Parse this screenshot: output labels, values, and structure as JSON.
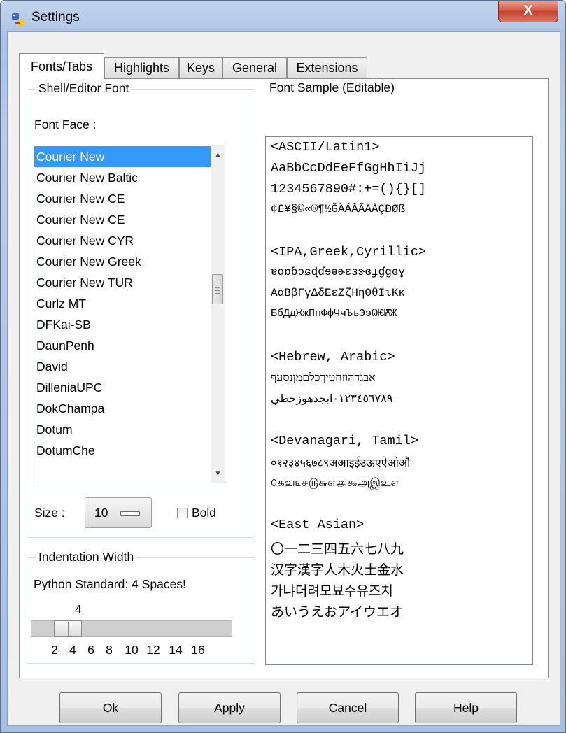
{
  "window": {
    "title": "Settings",
    "close_glyph": "X"
  },
  "tabs": [
    {
      "label": "Fonts/Tabs",
      "active": true
    },
    {
      "label": "Highlights",
      "active": false
    },
    {
      "label": "Keys",
      "active": false
    },
    {
      "label": "General",
      "active": false
    },
    {
      "label": "Extensions",
      "active": false
    }
  ],
  "font_group": {
    "title": "Shell/Editor Font",
    "face_label": "Font Face :",
    "fonts": [
      "Courier New",
      "Courier New Baltic",
      "Courier New CE",
      "Courier New CE",
      "Courier New CYR",
      "Courier New Greek",
      "Courier New TUR",
      "Curlz MT",
      "DFKai-SB",
      "DaunPenh",
      "David",
      "DilleniaUPC",
      "DokChampa",
      "Dotum",
      "DotumChe"
    ],
    "selected_font": "Courier New",
    "size_label": "Size :",
    "size_value": "10",
    "bold_label": "Bold",
    "bold_checked": false
  },
  "indent_group": {
    "title": "Indentation Width",
    "note": "Python Standard: 4 Spaces!",
    "value_label": "4",
    "value": 4,
    "ticks": [
      "2",
      "4",
      "6",
      "8",
      "10",
      "12",
      "14",
      "16"
    ]
  },
  "sample": {
    "title": "Font Sample (Editable)",
    "lines": [
      "<ASCII/Latin1>",
      "AaBbCcDdEeFfGgHhIiJj",
      "1234567890#:+=(){}[]",
      "¢£¥§©«®¶½ĞÀÁÂÃÄÅÇÐØß",
      "",
      "<IPA,Greek,Cyrillic>",
      "ɐɑɒɓɔɕɖɗɘəɚɛɜɝɞɟɠɡɢɣ",
      "ΑαΒβΓγΔδΕεΖζΗηΘθΙιΚκ",
      "БбДдЖжПпФфЧчЪъЭэѠѤѬӜ",
      "",
      "<Hebrew, Arabic>",
      "אבגדהוזחטיךכלםמןנסעף",
      "٠١٢٣٤٥٦٧٨٩ابجدهوزحطي",
      "",
      "<Devanagari, Tamil>",
      "०१२३४५६७८९अआइईउऊएऐओऔ",
      "௦௧௨௩௪௫௬௭௮௯அஇஉஎ",
      "",
      "<East Asian>",
      "〇一二三四五六七八九",
      "汉字漢字人木火土金水",
      "가냐더려모뵤수유즈치",
      "あいうえおアイウエオ"
    ]
  },
  "buttons": {
    "ok": "Ok",
    "apply": "Apply",
    "cancel": "Cancel",
    "help": "Help"
  }
}
